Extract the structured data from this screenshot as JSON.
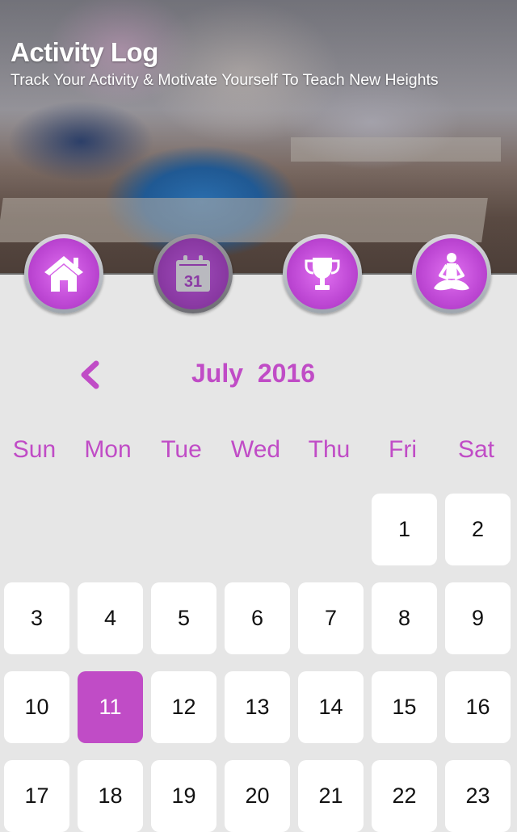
{
  "header": {
    "title": "Activity Log",
    "subtitle": "Track Your Activity & Motivate Yourself To Teach New Heights"
  },
  "nav": [
    {
      "name": "home",
      "icon": "home-icon",
      "active": false
    },
    {
      "name": "calendar",
      "icon": "calendar-icon",
      "icon_text": "31",
      "active": true
    },
    {
      "name": "achievements",
      "icon": "trophy-icon",
      "active": false
    },
    {
      "name": "yoga",
      "icon": "meditation-icon",
      "active": false
    }
  ],
  "calendar": {
    "prev_icon": "chevron-left-icon",
    "month_label": "July  2016",
    "weekdays": [
      "Sun",
      "Mon",
      "Tue",
      "Wed",
      "Thu",
      "Fri",
      "Sat"
    ],
    "first_weekday_index": 5,
    "selected_day": 11,
    "days": [
      1,
      2,
      3,
      4,
      5,
      6,
      7,
      8,
      9,
      10,
      11,
      12,
      13,
      14,
      15,
      16,
      17,
      18,
      19,
      20,
      21,
      22,
      23
    ]
  },
  "colors": {
    "accent": "#c04cc6",
    "background": "#e6e6e6",
    "day_bg": "#ffffff"
  }
}
